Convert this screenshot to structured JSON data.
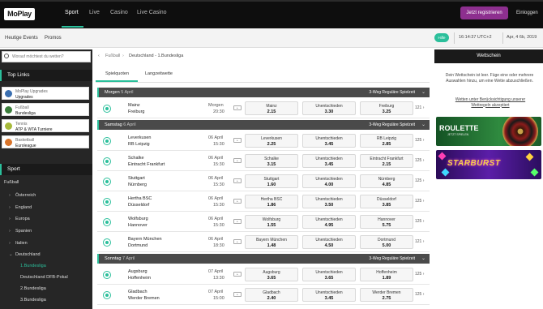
{
  "brand": {
    "logo": "MoPlay",
    "accent": "#2bbf9b",
    "register_color": "#8d2f8f"
  },
  "topnav": {
    "items": [
      "Sport",
      "Live",
      "Casino",
      "Live Casino"
    ],
    "active": "Sport",
    "register": "Jetzt registrieren",
    "login": "Einloggen"
  },
  "subnav": {
    "items": [
      "Heutige Events",
      "Promos"
    ],
    "help": "Hilfe",
    "time": "16:14:37 UTC+2",
    "date": "Apr, 4 6b, 2019"
  },
  "sidebar": {
    "search_placeholder": "Worauf möchtest du wetten?",
    "toplinks_title": "Top Links",
    "toplinks": [
      {
        "line1": "MoPlay Upgrades",
        "line2": "Upgrades"
      },
      {
        "line1": "Fußball",
        "line2": "Bundesliga"
      },
      {
        "line1": "Tennis",
        "line2": "ATP & WTA Turniere"
      },
      {
        "line1": "Basketball",
        "line2": "Euroleague"
      }
    ],
    "sport_title": "Sport",
    "sport_head": "Fußball",
    "countries": [
      "Österreich",
      "England",
      "Europa",
      "Spanien",
      "Italien",
      "Deutschland"
    ],
    "leagues": [
      "1.Bundesliga",
      "Deutschland DFB-Pokal",
      "2.Bundesliga",
      "3.Bundesliga"
    ]
  },
  "main": {
    "breadcrumb": [
      "Fußball",
      "Deutschland - 1.Bundesliga"
    ],
    "tabs": [
      "Spielquoten",
      "Langzeitwette"
    ],
    "market": "3-Weg Reguläre Spielzeit",
    "sections": [
      {
        "day": "Morgen",
        "date": "5 April",
        "matches": [
          {
            "home": "Mainz",
            "away": "Freiburg",
            "d1": "Morgen",
            "d2": "20:30",
            "odds": [
              [
                "Mainz",
                "2.15"
              ],
              [
                "Unentschieden",
                "3.30"
              ],
              [
                "Freiburg",
                "3.25"
              ]
            ],
            "more": "121"
          }
        ]
      },
      {
        "day": "Samstag",
        "date": "6 April",
        "matches": [
          {
            "home": "Leverkusen",
            "away": "RB Leipzig",
            "d1": "06 April",
            "d2": "15:30",
            "odds": [
              [
                "Leverkusen",
                "2.25"
              ],
              [
                "Unentschieden",
                "3.45"
              ],
              [
                "RB Leipzig",
                "2.85"
              ]
            ],
            "more": "125"
          },
          {
            "home": "Schalke",
            "away": "Eintracht Frankfurt",
            "d1": "06 April",
            "d2": "15:30",
            "odds": [
              [
                "Schalke",
                "3.15"
              ],
              [
                "Unentschieden",
                "3.45"
              ],
              [
                "Eintracht Frankfurt",
                "2.15"
              ]
            ],
            "more": "125"
          },
          {
            "home": "Stuttgart",
            "away": "Nürnberg",
            "d1": "06 April",
            "d2": "15:30",
            "odds": [
              [
                "Stuttgart",
                "1.60"
              ],
              [
                "Unentschieden",
                "4.00"
              ],
              [
                "Nürnberg",
                "4.85"
              ]
            ],
            "more": "125"
          },
          {
            "home": "Hertha BSC",
            "away": "Düsseldorf",
            "d1": "06 April",
            "d2": "15:30",
            "odds": [
              [
                "Hertha BSC",
                "1.86"
              ],
              [
                "Unentschieden",
                "3.50"
              ],
              [
                "Düsseldorf",
                "3.85"
              ]
            ],
            "more": "125"
          },
          {
            "home": "Wolfsburg",
            "away": "Hannover",
            "d1": "06 April",
            "d2": "15:30",
            "odds": [
              [
                "Wolfsburg",
                "1.55"
              ],
              [
                "Unentschieden",
                "4.95"
              ],
              [
                "Hannover",
                "5.75"
              ]
            ],
            "more": "125"
          },
          {
            "home": "Bayern München",
            "away": "Dortmund",
            "d1": "06 April",
            "d2": "18:30",
            "odds": [
              [
                "Bayern München",
                "1.48"
              ],
              [
                "Unentschieden",
                "4.50"
              ],
              [
                "Dortmund",
                "5.00"
              ]
            ],
            "more": "121"
          }
        ]
      },
      {
        "day": "Sonntag",
        "date": "7 April",
        "matches": [
          {
            "home": "Augsburg",
            "away": "Hoffenheim",
            "d1": "07 April",
            "d2": "13:30",
            "odds": [
              [
                "Augsburg",
                "3.65"
              ],
              [
                "Unentschieden",
                "3.65"
              ],
              [
                "Hoffenheim",
                "1.89"
              ]
            ],
            "more": "125"
          },
          {
            "home": "Gladbach",
            "away": "Werder Bremen",
            "d1": "07 April",
            "d2": "15:00",
            "odds": [
              [
                "Gladbach",
                "2.40"
              ],
              [
                "Unentschieden",
                "3.45"
              ],
              [
                "Werder Bremen",
                "2.75"
              ]
            ],
            "more": "125"
          }
        ]
      }
    ]
  },
  "betslip": {
    "title": "Wettschein",
    "empty_text": "Dein Wettschein ist leer. Füge eine oder mehrere Auswahlen hinzu, um eine Wette abzuschließen.",
    "link": "Wetten unter Berücksichtigung unserer Wettregeln akzeptiert",
    "banner1": {
      "title": "ROULETTE",
      "sub": "JETZT SPIELEN"
    },
    "banner2": {
      "title": "STARBURST"
    }
  }
}
